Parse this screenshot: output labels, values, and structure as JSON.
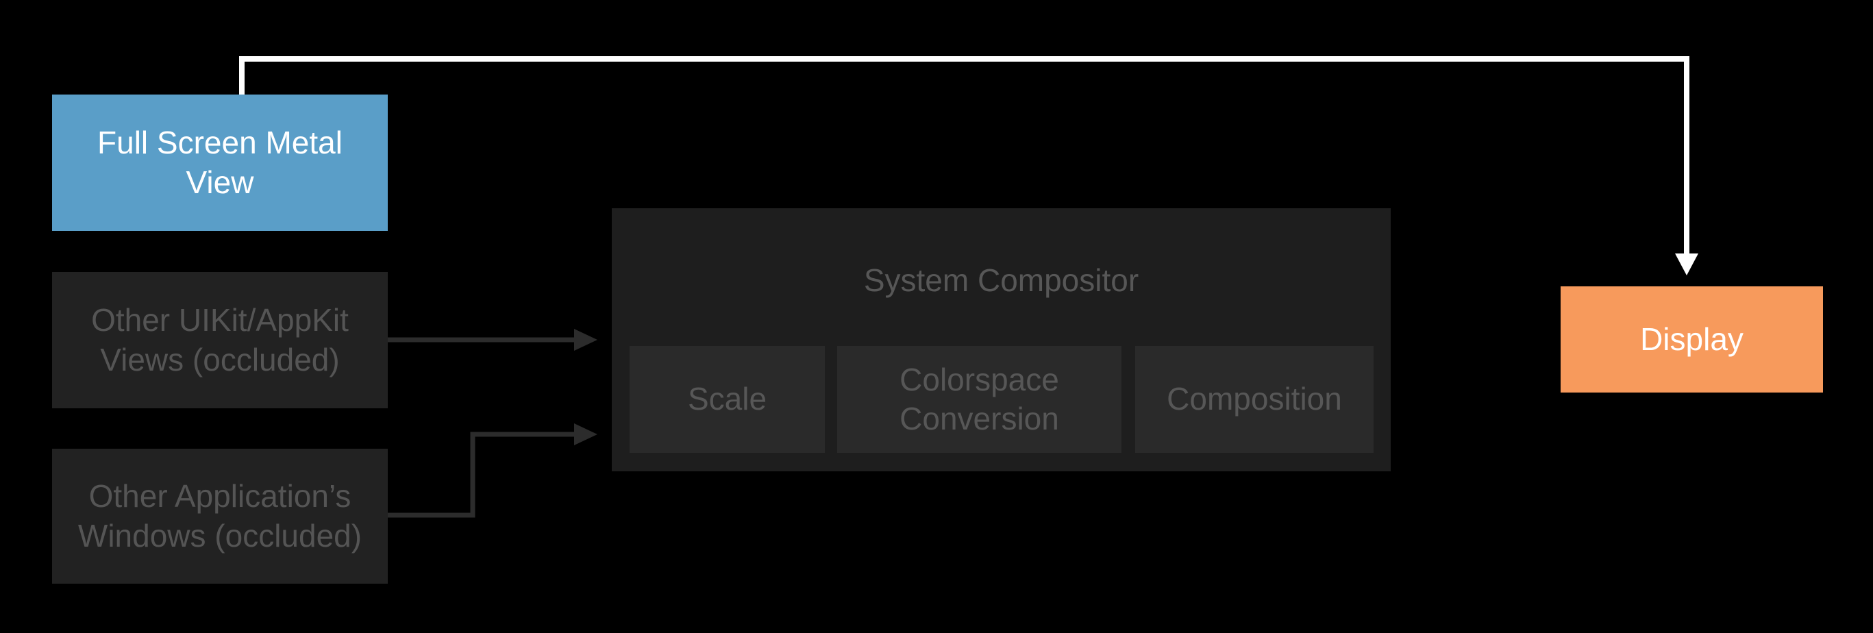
{
  "colors": {
    "background": "#000000",
    "metal_view": "#5a9ec8",
    "display": "#f79a5c",
    "occluded_box": "#222222",
    "occluded_text": "#555555",
    "compositor_bg": "#1e1e1e",
    "compositor_stage": "#2a2a2a",
    "compositor_text": "#575757",
    "active_line": "#ffffff",
    "inactive_line": "#2c2c2c"
  },
  "nodes": {
    "metal_view": "Full Screen Metal\nView",
    "uikit_views": "Other UIKit/AppKit\nViews (occluded)",
    "other_app_windows": "Other Application’s\nWindows (occluded)",
    "compositor_title": "System Compositor",
    "stage_scale": "Scale",
    "stage_colorspace": "Colorspace\nConversion",
    "stage_composition": "Composition",
    "display": "Display"
  }
}
